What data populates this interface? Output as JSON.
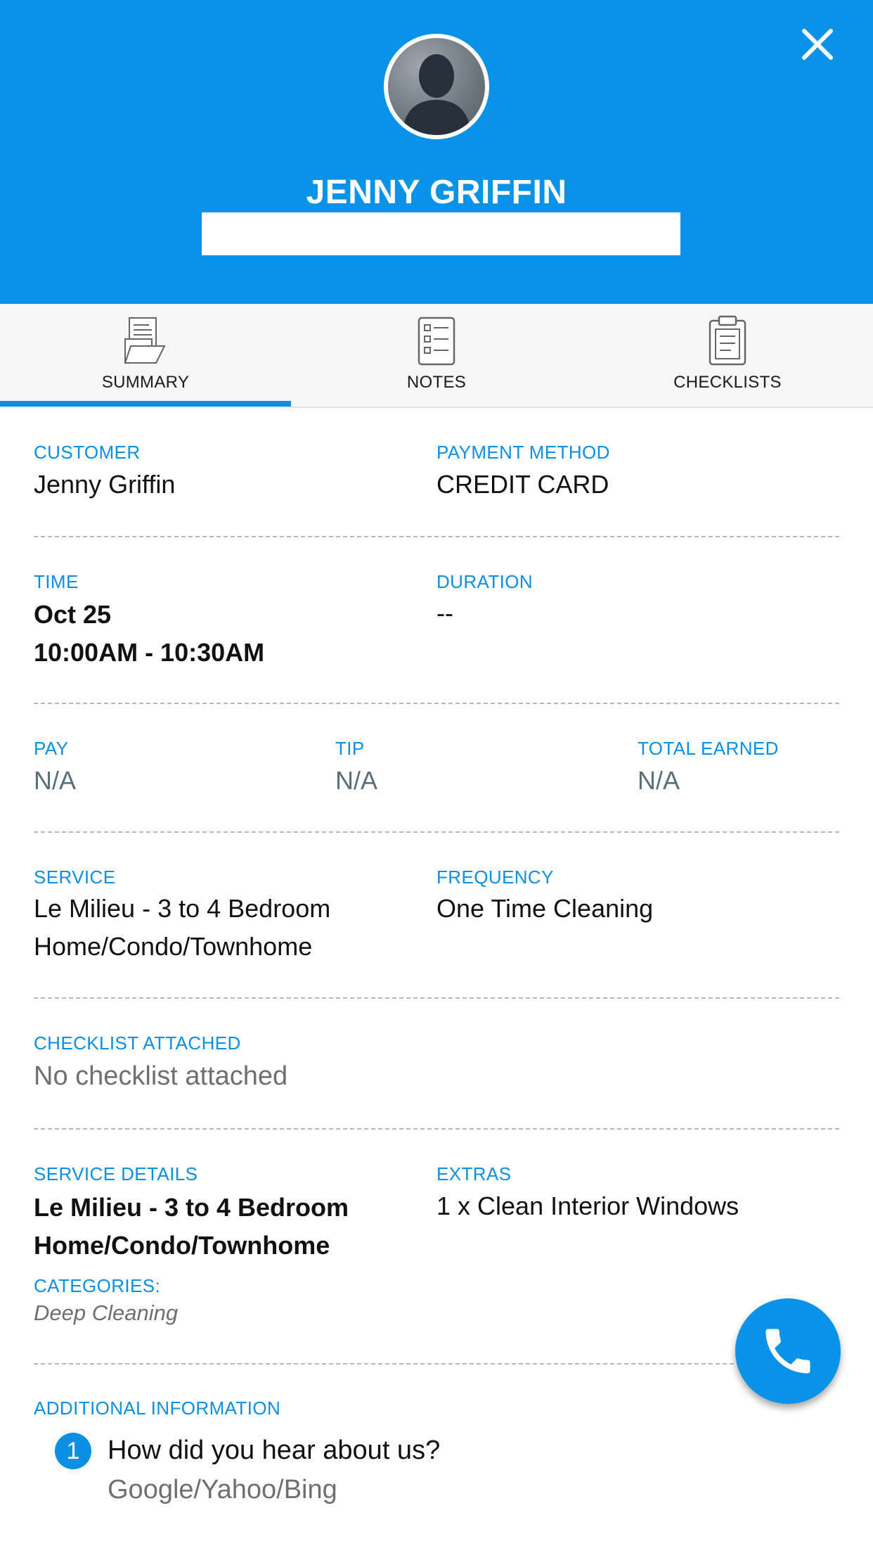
{
  "header": {
    "name": "JENNY GRIFFIN",
    "close_icon": "close-icon",
    "avatar_icon": "person-silhouette"
  },
  "tabs": [
    {
      "label": "SUMMARY",
      "icon": "document-stack-icon",
      "active": true
    },
    {
      "label": "NOTES",
      "icon": "notes-list-icon",
      "active": false
    },
    {
      "label": "CHECKLISTS",
      "icon": "clipboard-icon",
      "active": false
    }
  ],
  "summary": {
    "customer": {
      "label": "CUSTOMER",
      "value": "Jenny Griffin"
    },
    "payment_method": {
      "label": "PAYMENT METHOD",
      "value": "CREDIT CARD"
    },
    "time": {
      "label": "TIME",
      "date": "Oct 25",
      "range": "10:00AM - 10:30AM"
    },
    "duration": {
      "label": "DURATION",
      "value": "--"
    },
    "pay": {
      "label": "PAY",
      "value": "N/A"
    },
    "tip": {
      "label": "TIP",
      "value": "N/A"
    },
    "total_earned": {
      "label": "TOTAL EARNED",
      "value": "N/A"
    },
    "service": {
      "label": "SERVICE",
      "line1": "Le Milieu - 3 to 4 Bedroom",
      "line2": "Home/Condo/Townhome"
    },
    "frequency": {
      "label": "FREQUENCY",
      "value": "One Time Cleaning"
    },
    "checklist_attached": {
      "label": "CHECKLIST ATTACHED",
      "value": "No checklist attached"
    },
    "service_details": {
      "label": "SERVICE DETAILS",
      "line1": "Le Milieu - 3 to 4 Bedroom",
      "line2": "Home/Condo/Townhome",
      "categories_label": "CATEGORIES:",
      "categories_value": "Deep Cleaning"
    },
    "extras": {
      "label": "EXTRAS",
      "value": "1 x Clean Interior Windows"
    },
    "additional_information": {
      "label": "ADDITIONAL INFORMATION",
      "items": [
        {
          "number": "1",
          "question": "How did you hear about us?",
          "answer": "Google/Yahoo/Bing"
        }
      ]
    }
  },
  "fab": {
    "icon": "phone-icon"
  },
  "colors": {
    "primary": "#0892e8",
    "label_blue": "#0a8fe3",
    "tab_bg": "#f6f6f6"
  }
}
